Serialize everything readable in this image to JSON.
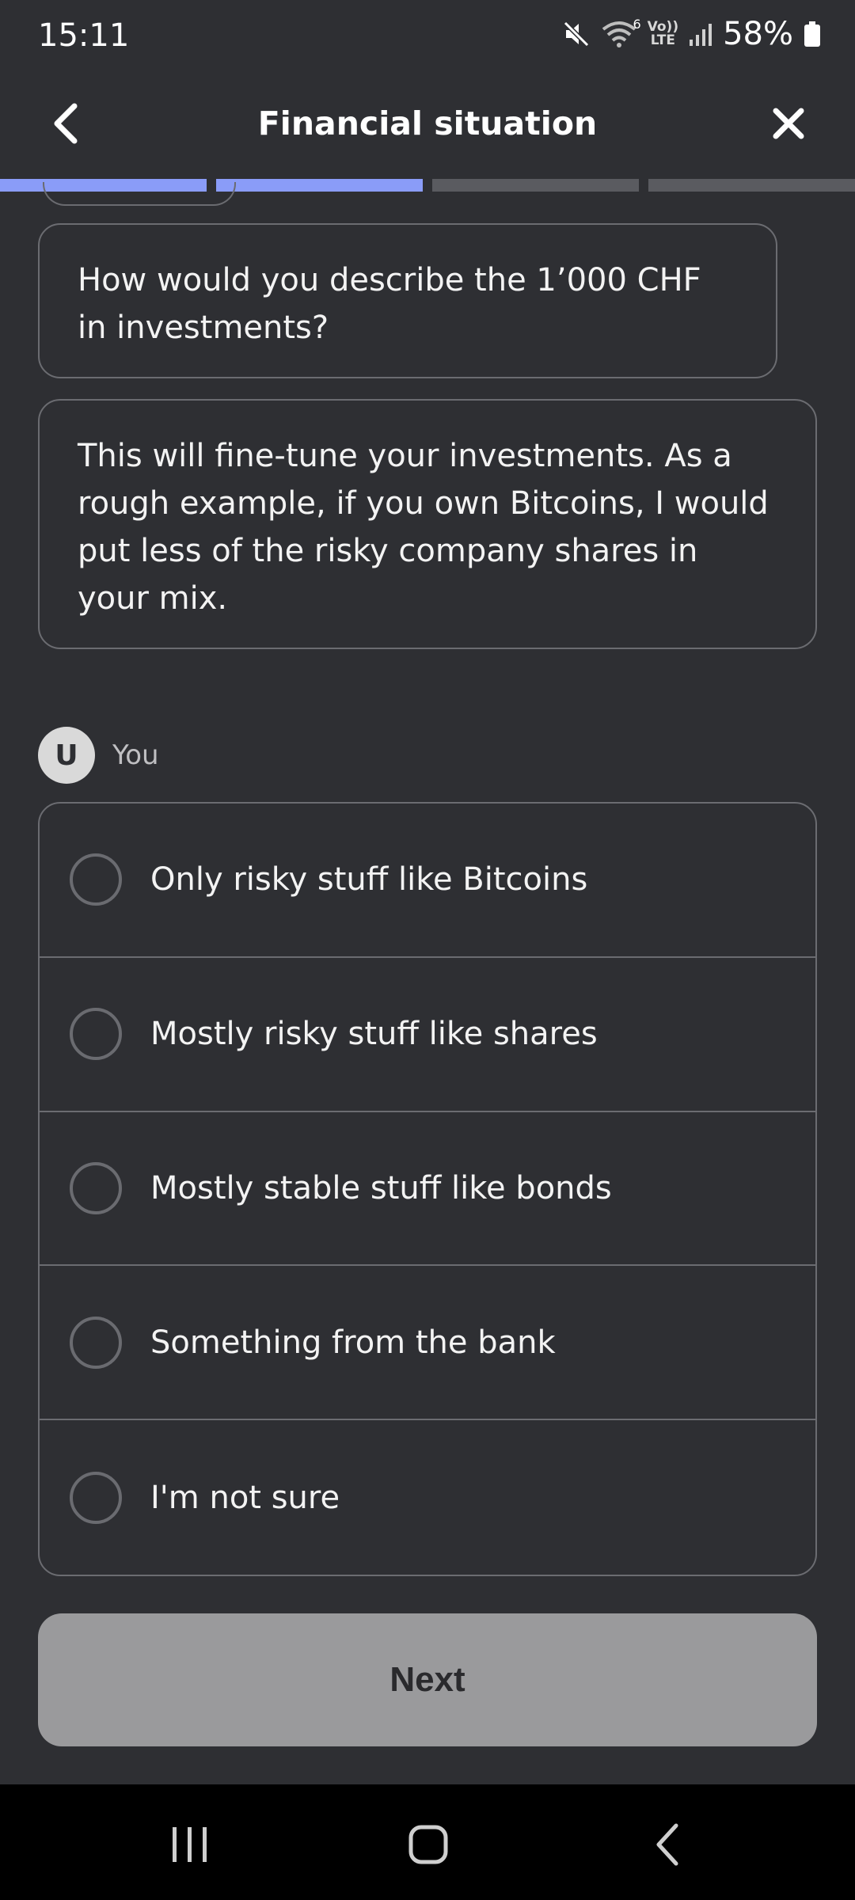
{
  "status_bar": {
    "time": "15:11",
    "network_badge": "6",
    "lte_top": "Vo))",
    "lte_bottom": "LTE",
    "battery": "58%"
  },
  "header": {
    "title": "Financial situation",
    "back_icon": "chevron-left-icon",
    "close_icon": "close-icon"
  },
  "progress": {
    "steps": [
      1.0,
      1.0,
      0.0,
      0.0
    ],
    "fill_color": "#8a9cf8",
    "track_color": "#5a5b60"
  },
  "conversation": {
    "question": "How would you describe the 1’000 CHF in investments?",
    "explanation": "This will fine-tune your investments. As a rough example, if you own Bitcoins, I would put less of the risky company shares in your mix."
  },
  "user": {
    "avatar_initial": "U",
    "label": "You"
  },
  "options": [
    {
      "label": "Only risky stuff like Bitcoins",
      "selected": false
    },
    {
      "label": "Mostly risky stuff like shares",
      "selected": false
    },
    {
      "label": "Mostly stable stuff like bonds",
      "selected": false
    },
    {
      "label": "Something from the bank",
      "selected": false
    },
    {
      "label": "I'm not sure",
      "selected": false
    }
  ],
  "next_button": {
    "label": "Next",
    "enabled": false
  },
  "nav_bar": {
    "recents_icon": "recents-icon",
    "home_icon": "home-icon",
    "back_icon": "back-icon"
  }
}
